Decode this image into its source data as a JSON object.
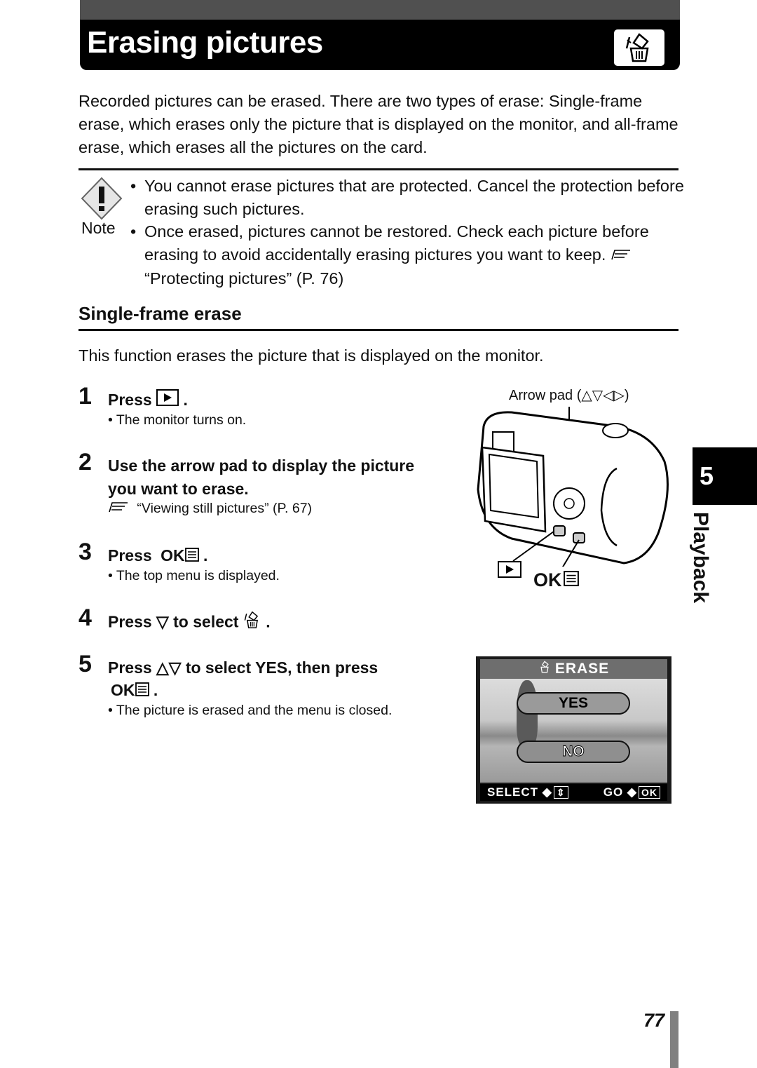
{
  "header": {
    "title": "Erasing pictures",
    "icon": "erase-trash-icon"
  },
  "intro": "Recorded pictures can be erased. There are two types of erase: Single-frame erase, which erases only the picture that is displayed on the monitor, and all-frame erase, which erases all the pictures on the card.",
  "note": {
    "label": "Note",
    "icon": "warning-diamond-icon",
    "items": [
      "You cannot erase pictures that are protected. Cancel the protection before erasing such pictures.",
      "Once erased, pictures cannot be restored. Check each picture before erasing to avoid accidentally erasing pictures you want to keep."
    ],
    "reference": "“Protecting pictures” (P. 76)"
  },
  "section": {
    "heading": "Single-frame erase",
    "description": "This function erases the picture that is displayed on the monitor."
  },
  "steps": [
    {
      "number": "1",
      "text": "Press",
      "suffix": ".",
      "key": "playback-key",
      "sub": "• The monitor turns on."
    },
    {
      "number": "2",
      "text": "Use the arrow pad to display the picture",
      "text2": "you want to erase.",
      "reference": "“Viewing still pictures” (P. 67)"
    },
    {
      "number": "3",
      "text": "Press",
      "key_label": "OK",
      "suffix": ".",
      "sub": "• The top menu is displayed."
    },
    {
      "number": "4",
      "text": "Press ▽ to select",
      "suffix": "."
    },
    {
      "number": "5",
      "text": "Press △▽ to select YES, then press",
      "key_label": "OK",
      "suffix": ".",
      "sub": "• The picture is erased and the menu is closed."
    }
  ],
  "camera_figure": {
    "arrow_pad_label": "Arrow pad (△▽◁▷)",
    "ok_label": "OK"
  },
  "lcd_screen": {
    "header": "ERASE",
    "yes": "YES",
    "no": "NO",
    "footer_select": "SELECT",
    "footer_go": "GO",
    "footer_ok": "OK"
  },
  "chapter": {
    "number": "5",
    "label": "Playback"
  },
  "page_number": "77"
}
